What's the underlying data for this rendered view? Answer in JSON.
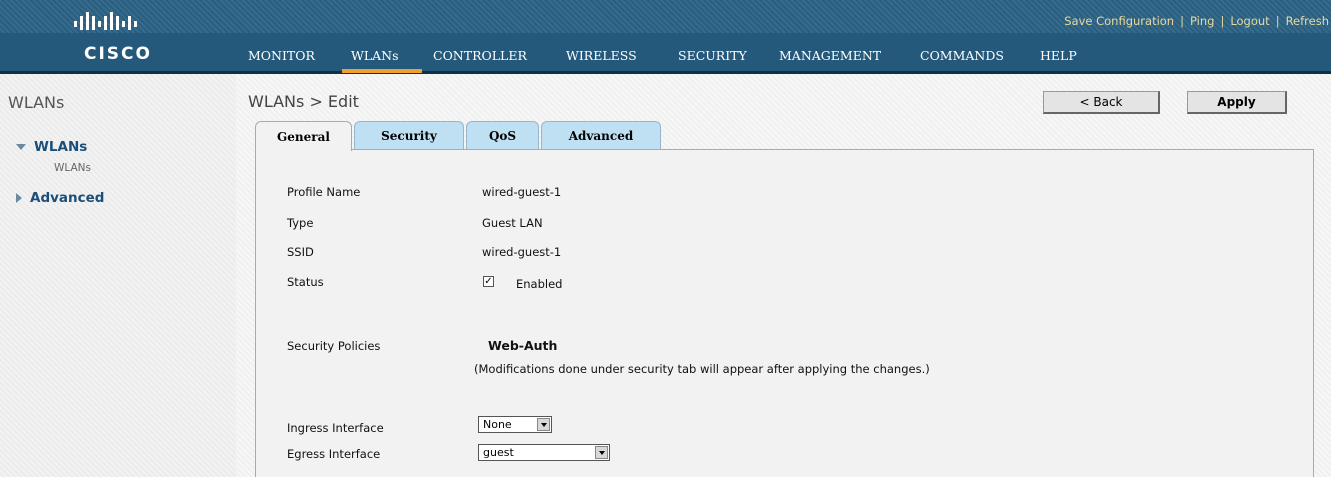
{
  "header": {
    "logo_text": "CISCO",
    "links": [
      "Save Configuration",
      "Ping",
      "Logout",
      "Refresh"
    ]
  },
  "nav": [
    "MONITOR",
    "WLANs",
    "CONTROLLER",
    "WIRELESS",
    "SECURITY",
    "MANAGEMENT",
    "COMMANDS",
    "HELP"
  ],
  "nav_active": "WLANs",
  "sidebar": {
    "title": "WLANs",
    "wlans_label": "WLANs",
    "wlans_sub": "WLANs",
    "advanced_label": "Advanced"
  },
  "page": {
    "title": "WLANs > Edit",
    "back_label": "< Back",
    "apply_label": "Apply"
  },
  "tabs": [
    "General",
    "Security",
    "QoS",
    "Advanced"
  ],
  "form": {
    "profile_name_label": "Profile Name",
    "profile_name_value": "wired-guest-1",
    "type_label": "Type",
    "type_value": "Guest LAN",
    "ssid_label": "SSID",
    "ssid_value": "wired-guest-1",
    "status_label": "Status",
    "status_checked": true,
    "status_value": "Enabled",
    "security_policies_label": "Security Policies",
    "security_policies_value": "Web-Auth",
    "security_note": "(Modifications done under security tab will appear after applying the changes.)",
    "ingress_label": "Ingress Interface",
    "ingress_value": "None",
    "egress_label": "Egress Interface",
    "egress_value": "guest"
  },
  "colors": {
    "header_bg": "#24597b",
    "active_tab_accent": "#f0a030",
    "link_color": "#e6d9a0",
    "sidebar_link": "#1b4f7a",
    "tab_bg": "#bfe0f2"
  }
}
